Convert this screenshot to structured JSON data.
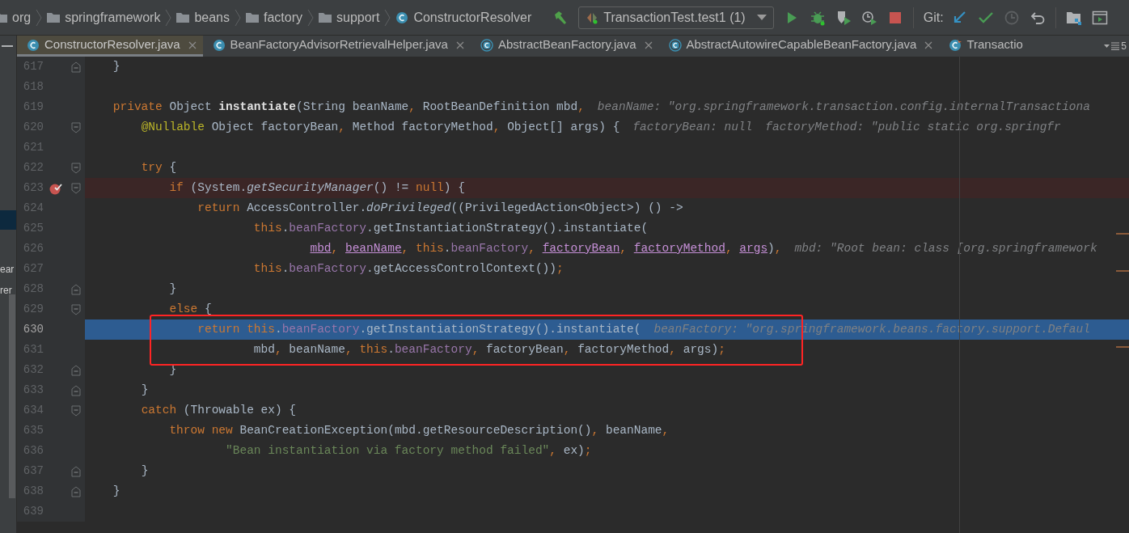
{
  "breadcrumbs": [
    {
      "label": "org",
      "kind": "package"
    },
    {
      "label": "springframework",
      "kind": "package"
    },
    {
      "label": "beans",
      "kind": "package"
    },
    {
      "label": "factory",
      "kind": "package"
    },
    {
      "label": "support",
      "kind": "package"
    },
    {
      "label": "ConstructorResolver",
      "kind": "class"
    }
  ],
  "run_config": {
    "label": "TransactionTest.test1 (1)"
  },
  "vcs_label": "Git:",
  "tabs": [
    {
      "label": "ConstructorResolver.java",
      "kind": "class",
      "selected": true,
      "closable": true
    },
    {
      "label": "BeanFactoryAdvisorRetrievalHelper.java",
      "kind": "class",
      "selected": false,
      "closable": true
    },
    {
      "label": "AbstractBeanFactory.java",
      "kind": "abstract",
      "selected": false,
      "closable": true
    },
    {
      "label": "AbstractAutowireCapableBeanFactory.java",
      "kind": "abstract",
      "selected": false,
      "closable": true
    },
    {
      "label": "Transactio",
      "kind": "test",
      "selected": false,
      "closable": false
    }
  ],
  "tab_overflow": {
    "count": "5"
  },
  "project_panel": {
    "fragments": [
      "ear",
      "rer"
    ]
  },
  "editor": {
    "lines": [
      {
        "number": "617",
        "breakpoint": false,
        "execution": false,
        "fold": {
          "kind": "end"
        },
        "tokens": [
          {
            "kind": "plain",
            "text": "    }"
          }
        ]
      },
      {
        "number": "618",
        "breakpoint": false,
        "execution": false
      },
      {
        "number": "619",
        "breakpoint": false,
        "execution": false,
        "tokens": [
          {
            "kind": "keyword",
            "text": "    private"
          },
          {
            "kind": "plain",
            "text": " Object "
          },
          {
            "kind": "declaration",
            "text": "instantiate"
          },
          {
            "kind": "plain",
            "text": "(String beanName"
          },
          {
            "kind": "keyword",
            "text": ","
          },
          {
            "kind": "plain",
            "text": " RootBeanDefinition mbd"
          },
          {
            "kind": "keyword",
            "text": ","
          }
        ],
        "hints": [
          "beanName: \"org.springframework.transaction.config.internalTransactiona"
        ]
      },
      {
        "number": "620",
        "breakpoint": false,
        "execution": false,
        "fold": {
          "kind": "start"
        },
        "tokens": [
          {
            "kind": "annotation",
            "text": "        @Nullable"
          },
          {
            "kind": "plain",
            "text": " Object factoryBean"
          },
          {
            "kind": "keyword",
            "text": ","
          },
          {
            "kind": "plain",
            "text": " Method factoryMethod"
          },
          {
            "kind": "keyword",
            "text": ","
          },
          {
            "kind": "plain",
            "text": " Object[] args) {"
          }
        ],
        "hints": [
          "factoryBean: null",
          "factoryMethod: \"public static org.springfr"
        ]
      },
      {
        "number": "621",
        "breakpoint": false,
        "execution": false
      },
      {
        "number": "622",
        "breakpoint": false,
        "execution": false,
        "fold": {
          "kind": "start"
        },
        "tokens": [
          {
            "kind": "keyword",
            "text": "        try"
          },
          {
            "kind": "plain",
            "text": " {"
          }
        ]
      },
      {
        "number": "623",
        "breakpoint": true,
        "execution": false,
        "fold": {
          "kind": "start"
        },
        "tokens": [
          {
            "kind": "keyword",
            "text": "            if"
          },
          {
            "kind": "plain",
            "text": " (System."
          },
          {
            "kind": "static",
            "text": "getSecurityManager"
          },
          {
            "kind": "plain",
            "text": "() != "
          },
          {
            "kind": "keyword",
            "text": "null"
          },
          {
            "kind": "plain",
            "text": ") {"
          }
        ]
      },
      {
        "number": "624",
        "breakpoint": false,
        "execution": false,
        "tokens": [
          {
            "kind": "keyword",
            "text": "                return"
          },
          {
            "kind": "plain",
            "text": " AccessController."
          },
          {
            "kind": "static",
            "text": "doPrivileged"
          },
          {
            "kind": "plain",
            "text": "((PrivilegedAction<Object>) () ->"
          }
        ]
      },
      {
        "number": "625",
        "breakpoint": false,
        "execution": false,
        "tokens": [
          {
            "kind": "keyword",
            "text": "                        this"
          },
          {
            "kind": "plain",
            "text": "."
          },
          {
            "kind": "field",
            "text": "beanFactory"
          },
          {
            "kind": "plain",
            "text": ".getInstantiationStrategy().instantiate("
          }
        ]
      },
      {
        "number": "626",
        "breakpoint": false,
        "execution": false,
        "tokens": [
          {
            "kind": "captured",
            "text": "                                mbd"
          },
          {
            "kind": "keyword",
            "text": ", "
          },
          {
            "kind": "captured",
            "text": "beanName"
          },
          {
            "kind": "keyword",
            "text": ", this"
          },
          {
            "kind": "plain",
            "text": "."
          },
          {
            "kind": "field",
            "text": "beanFactory"
          },
          {
            "kind": "keyword",
            "text": ", "
          },
          {
            "kind": "captured",
            "text": "factoryBean"
          },
          {
            "kind": "keyword",
            "text": ", "
          },
          {
            "kind": "captured",
            "text": "factoryMethod"
          },
          {
            "kind": "keyword",
            "text": ", "
          },
          {
            "kind": "captured",
            "text": "args"
          },
          {
            "kind": "plain",
            "text": ")"
          },
          {
            "kind": "keyword",
            "text": ","
          }
        ],
        "hints": [
          "mbd: \"Root bean: class [org.springframework"
        ]
      },
      {
        "number": "627",
        "breakpoint": false,
        "execution": false,
        "tokens": [
          {
            "kind": "keyword",
            "text": "                        this"
          },
          {
            "kind": "plain",
            "text": "."
          },
          {
            "kind": "field",
            "text": "beanFactory"
          },
          {
            "kind": "plain",
            "text": ".getAccessControlContext())"
          },
          {
            "kind": "keyword",
            "text": ";"
          }
        ]
      },
      {
        "number": "628",
        "breakpoint": false,
        "execution": false,
        "fold": {
          "kind": "end"
        },
        "tokens": [
          {
            "kind": "plain",
            "text": "            }"
          }
        ]
      },
      {
        "number": "629",
        "breakpoint": false,
        "execution": false,
        "fold": {
          "kind": "start"
        },
        "tokens": [
          {
            "kind": "keyword",
            "text": "            else"
          },
          {
            "kind": "plain",
            "text": " {"
          }
        ]
      },
      {
        "number": "630",
        "breakpoint": false,
        "execution": true,
        "tokens": [
          {
            "kind": "keyword",
            "text": "                return this"
          },
          {
            "kind": "plain",
            "text": "."
          },
          {
            "kind": "field",
            "text": "beanFactory"
          },
          {
            "kind": "plain",
            "text": ".getInstantiationStrategy().instantiate("
          }
        ],
        "hints": [
          "beanFactory: \"org.springframework.beans.factory.support.Defaul"
        ]
      },
      {
        "number": "631",
        "breakpoint": false,
        "execution": false,
        "tokens": [
          {
            "kind": "plain",
            "text": "                        mbd"
          },
          {
            "kind": "keyword",
            "text": ", "
          },
          {
            "kind": "plain",
            "text": "beanName"
          },
          {
            "kind": "keyword",
            "text": ", this"
          },
          {
            "kind": "plain",
            "text": "."
          },
          {
            "kind": "field",
            "text": "beanFactory"
          },
          {
            "kind": "keyword",
            "text": ", "
          },
          {
            "kind": "plain",
            "text": "factoryBean"
          },
          {
            "kind": "keyword",
            "text": ", "
          },
          {
            "kind": "plain",
            "text": "factoryMethod"
          },
          {
            "kind": "keyword",
            "text": ", "
          },
          {
            "kind": "plain",
            "text": "args)"
          },
          {
            "kind": "keyword",
            "text": ";"
          }
        ]
      },
      {
        "number": "632",
        "breakpoint": false,
        "execution": false,
        "fold": {
          "kind": "end"
        },
        "tokens": [
          {
            "kind": "plain",
            "text": "            }"
          }
        ]
      },
      {
        "number": "633",
        "breakpoint": false,
        "execution": false,
        "fold": {
          "kind": "end"
        },
        "tokens": [
          {
            "kind": "plain",
            "text": "        }"
          }
        ]
      },
      {
        "number": "634",
        "breakpoint": false,
        "execution": false,
        "fold": {
          "kind": "start"
        },
        "tokens": [
          {
            "kind": "keyword",
            "text": "        catch"
          },
          {
            "kind": "plain",
            "text": " (Throwable ex) {"
          }
        ]
      },
      {
        "number": "635",
        "breakpoint": false,
        "execution": false,
        "tokens": [
          {
            "kind": "keyword",
            "text": "            throw new"
          },
          {
            "kind": "plain",
            "text": " BeanCreationException(mbd.getResourceDescription()"
          },
          {
            "kind": "keyword",
            "text": ","
          },
          {
            "kind": "plain",
            "text": " beanName"
          },
          {
            "kind": "keyword",
            "text": ","
          }
        ]
      },
      {
        "number": "636",
        "breakpoint": false,
        "execution": false,
        "tokens": [
          {
            "kind": "string",
            "text": "                    \"Bean instantiation via factory method failed\""
          },
          {
            "kind": "keyword",
            "text": ","
          },
          {
            "kind": "plain",
            "text": " ex)"
          },
          {
            "kind": "keyword",
            "text": ";"
          }
        ]
      },
      {
        "number": "637",
        "breakpoint": false,
        "execution": false,
        "fold": {
          "kind": "end"
        },
        "tokens": [
          {
            "kind": "plain",
            "text": "        }"
          }
        ]
      },
      {
        "number": "638",
        "breakpoint": false,
        "execution": false,
        "fold": {
          "kind": "end"
        },
        "tokens": [
          {
            "kind": "plain",
            "text": "    }"
          }
        ]
      },
      {
        "number": "639",
        "breakpoint": false,
        "execution": false
      }
    ]
  }
}
